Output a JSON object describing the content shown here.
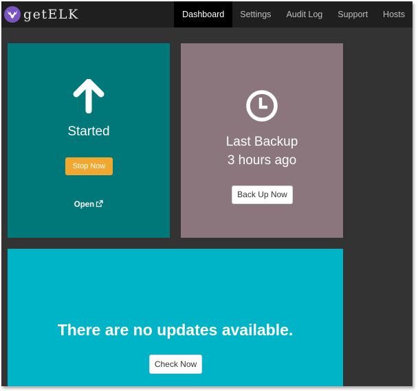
{
  "app": {
    "brand": "getELK",
    "logo_icon": "elk-head-icon",
    "colors": {
      "navbar": "#1f1f1f",
      "background": "#333333",
      "status_card": "#00787a",
      "backup_card": "#8b767d",
      "updates_card": "#00b4c8",
      "accent_orange": "#f0a830"
    }
  },
  "nav": {
    "items": [
      {
        "label": "Dashboard",
        "active": true
      },
      {
        "label": "Settings",
        "active": false
      },
      {
        "label": "Audit Log",
        "active": false
      },
      {
        "label": "Support",
        "active": false
      },
      {
        "label": "Hosts",
        "active": false
      }
    ]
  },
  "status_card": {
    "icon": "arrow-up-icon",
    "status": "Started",
    "stop_label": "Stop Now",
    "open_label": "Open",
    "open_icon": "external-link-icon"
  },
  "backup_card": {
    "icon": "clock-icon",
    "title": "Last Backup",
    "time": "3 hours ago",
    "button_label": "Back Up Now"
  },
  "updates_card": {
    "message": "There are no updates available.",
    "button_label": "Check Now"
  }
}
